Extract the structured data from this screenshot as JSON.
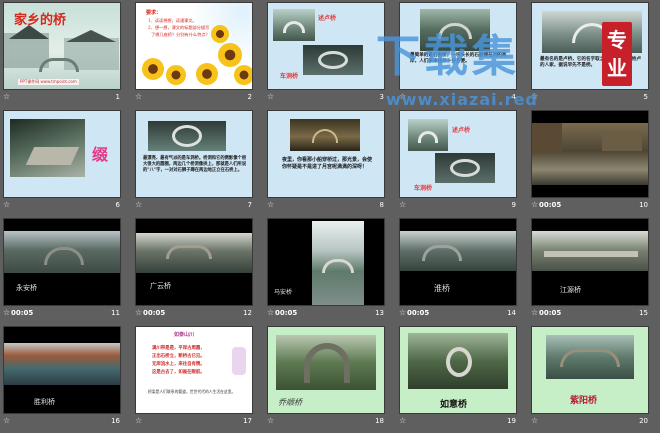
{
  "slides": [
    {
      "num": "1",
      "time": "",
      "title": "家乡的桥",
      "footer": "PPT课件网 www.tmpoint.com"
    },
    {
      "num": "2",
      "time": "",
      "heading": "要求：",
      "line1": "1、读读想想，读通课文。",
      "line2": "2、想一想，课文的标题部分描写",
      "line3": "了哪几座桥？分别有什么特点？"
    },
    {
      "num": "3",
      "time": "",
      "label1": "述卢桥",
      "label2": "车洞桥"
    },
    {
      "num": "4",
      "time": "",
      "text": "最简单的是石板桥，一块长长的石板铺在河的两岸，人们来来往往十分方便。"
    },
    {
      "num": "5",
      "time": "",
      "text": "最有名的是卢桥，它的名字取之于桥旁的一家姓卢的人家，据说早先不是桥。"
    },
    {
      "num": "6",
      "time": "",
      "glyph": "缀"
    },
    {
      "num": "7",
      "time": "",
      "text": "最漂亮、最有气派的是车洞桥。桥洞和它的倒影像个很大很大的圆圈，两边几个桥洞像拱上，那就是人们所说的\"八\"字，一对对石狮子蹲在两边地正立在石桥上。"
    },
    {
      "num": "8",
      "time": "",
      "text": "夜里，你看那小船穿桥过，那光景，会使你怀疑是不是进了月宫呢满满的深呀！"
    },
    {
      "num": "9",
      "time": "",
      "label1": "述卢桥",
      "label2": "车洞桥"
    },
    {
      "num": "10",
      "time": "00:05"
    },
    {
      "num": "11",
      "time": "00:05",
      "caption": "永安桥"
    },
    {
      "num": "12",
      "time": "00:05",
      "caption": "广云桥"
    },
    {
      "num": "13",
      "time": "00:05",
      "caption": "马安桥"
    },
    {
      "num": "14",
      "time": "00:05",
      "caption": "淮桥"
    },
    {
      "num": "15",
      "time": "00:05",
      "caption": "江源桥"
    },
    {
      "num": "16",
      "time": "",
      "caption": "胜利桥"
    },
    {
      "num": "17",
      "time": "",
      "heading": "如泰山川",
      "line1": "满川带是是，平岸古周圆，",
      "line2": "正出石桥立，断桥古已见。",
      "line3": "无岸流水上，来往自有情。",
      "line4": "这是古去了，如画在眼前。",
      "footer": "桥梁是人们联系的要道，世世代代的人生活在这里。"
    },
    {
      "num": "18",
      "time": "",
      "caption": "乔顺桥"
    },
    {
      "num": "19",
      "time": "",
      "caption": "如意桥"
    },
    {
      "num": "20",
      "time": "",
      "caption": "紫阳桥"
    }
  ],
  "star_icon": "☆",
  "watermark": {
    "line1": "下载集",
    "badge": "专业",
    "url": "www.xiazai.red"
  }
}
